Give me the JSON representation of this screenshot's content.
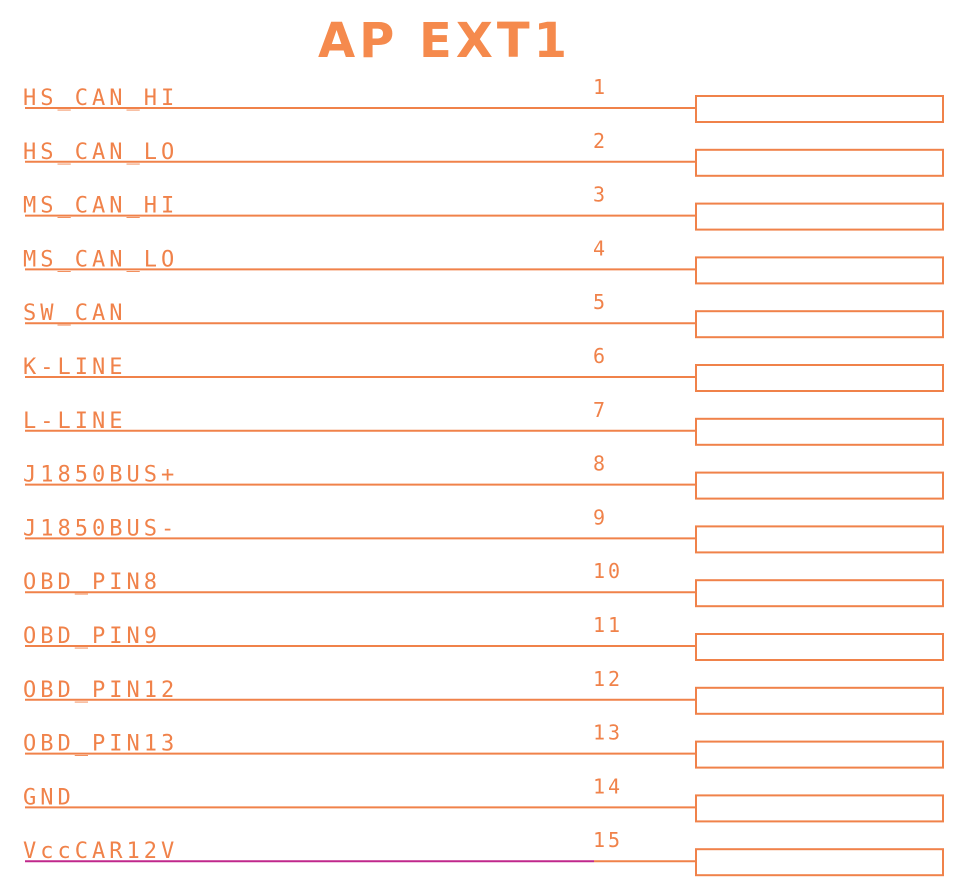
{
  "title": "AP EXT1",
  "colors": {
    "line": "#f0824a",
    "title": "#f58a4d",
    "highlight_wire": "#c0288c",
    "background": "#ffffff"
  },
  "pins": [
    {
      "net": "HS_CAN_HI",
      "number": "1"
    },
    {
      "net": "HS_CAN_LO",
      "number": "2"
    },
    {
      "net": "MS_CAN_HI",
      "number": "3"
    },
    {
      "net": "MS_CAN_LO",
      "number": "4"
    },
    {
      "net": "SW_CAN",
      "number": "5"
    },
    {
      "net": "K-LINE",
      "number": "6"
    },
    {
      "net": "L-LINE",
      "number": "7"
    },
    {
      "net": "J1850BUS+",
      "number": "8"
    },
    {
      "net": "J1850BUS-",
      "number": "9"
    },
    {
      "net": "OBD_PIN8",
      "number": "10"
    },
    {
      "net": "OBD_PIN9",
      "number": "11"
    },
    {
      "net": "OBD_PIN12",
      "number": "12"
    },
    {
      "net": "OBD_PIN13",
      "number": "13"
    },
    {
      "net": "GND",
      "number": "14"
    },
    {
      "net": "VccCAR12V",
      "number": "15",
      "highlight": true
    }
  ]
}
